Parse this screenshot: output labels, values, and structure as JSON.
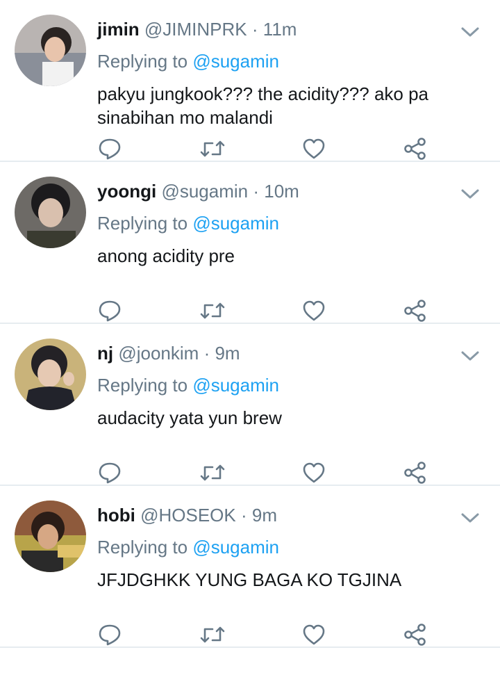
{
  "replying_prefix": "Replying to",
  "tweets": [
    {
      "name": "jimin",
      "handle": "@JIMINPRK",
      "dot": "·",
      "time": "11m",
      "mention": "@sugamin",
      "text": "pakyu jungkook??? the acidity??? ako pa sinabihan mo malandi"
    },
    {
      "name": "yoongi",
      "handle": "@sugamin",
      "dot": "·",
      "time": "10m",
      "mention": "@sugamin",
      "text": "anong acidity pre"
    },
    {
      "name": "nj",
      "handle": "@joonkim",
      "dot": "·",
      "time": "9m",
      "mention": "@sugamin",
      "text": "audacity yata yun brew"
    },
    {
      "name": "hobi",
      "handle": "@HOSEOK",
      "dot": "·",
      "time": "9m",
      "mention": "@sugamin",
      "text": "JFJDGHKK YUNG BAGA KO TGJINA"
    }
  ],
  "colors": {
    "accent": "#1da1f2",
    "muted": "#657786",
    "icon": "#657786",
    "divider": "#e6ecf0"
  },
  "icons": [
    "reply-icon",
    "retweet-icon",
    "like-icon",
    "share-icon",
    "chevron-down-icon"
  ]
}
